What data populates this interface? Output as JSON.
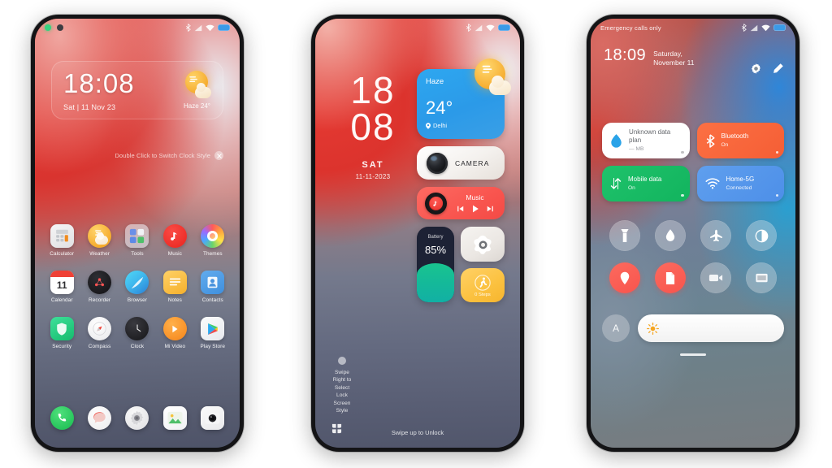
{
  "scene": {
    "background_color": "#ffffff",
    "phone_count": 3
  },
  "phone1": {
    "name": "lock-screen-home",
    "status_bar": {
      "left_text": "",
      "icons": [
        "bluetooth-icon",
        "signal-icon",
        "wifi-icon",
        "battery-icon"
      ]
    },
    "lock_card": {
      "time": "18:08",
      "date": "Sat | 11 Nov 23",
      "weather": "Haze 24°",
      "weather_icon": "haze-sun-cloud-icon"
    },
    "hint": {
      "text": "Double Click to Switch Clock Style",
      "icon": "close-icon"
    },
    "apps": [
      {
        "label": "Calculator",
        "icon": "calculator-icon",
        "color": "#e9e9ea"
      },
      {
        "label": "Weather",
        "icon": "weather-icon",
        "color": "#f6b53a"
      },
      {
        "label": "Tools",
        "icon": "tools-folder-icon",
        "color": "#f2f4f8"
      },
      {
        "label": "Music",
        "icon": "music-icon",
        "color": "#ef3b39"
      },
      {
        "label": "Themes",
        "icon": "themes-icon",
        "color": "#ffffff"
      },
      {
        "label": "Calendar",
        "icon": "calendar-icon",
        "color": "#ffffff"
      },
      {
        "label": "Recorder",
        "icon": "recorder-icon",
        "color": "#1d1d20"
      },
      {
        "label": "Browser",
        "icon": "browser-icon",
        "color": "#39b9ee"
      },
      {
        "label": "Notes",
        "icon": "notes-icon",
        "color": "#f6b93b"
      },
      {
        "label": "Contacts",
        "icon": "contacts-icon",
        "color": "#4a9fe8"
      },
      {
        "label": "Security",
        "icon": "security-icon",
        "color": "#21c46d"
      },
      {
        "label": "Compass",
        "icon": "compass-icon",
        "color": "#ffffff"
      },
      {
        "label": "Clock",
        "icon": "clock-icon",
        "color": "#222226"
      },
      {
        "label": "Mi Video",
        "icon": "mi-video-icon",
        "color": "#f7921e"
      },
      {
        "label": "Play Store",
        "icon": "play-store-icon",
        "color": "#f2f3f6"
      }
    ],
    "dock": [
      {
        "label": "Phone",
        "icon": "phone-icon",
        "color": "#2ecc5c"
      },
      {
        "label": "Messages",
        "icon": "messages-icon",
        "color": "#f2f2f3"
      },
      {
        "label": "Settings",
        "icon": "settings-gear-icon",
        "color": "#e6e6e8"
      },
      {
        "label": "Gallery",
        "icon": "gallery-icon",
        "color": "#ffffff"
      },
      {
        "label": "Camera",
        "icon": "camera-icon",
        "color": "#efeff0"
      }
    ]
  },
  "phone2": {
    "name": "lock-screen-widgets",
    "status_bar": {
      "icons": [
        "bluetooth-icon",
        "signal-icon",
        "wifi-icon",
        "battery-icon"
      ]
    },
    "clock": {
      "hours": "18",
      "minutes": "08",
      "weekday": "SAT",
      "date": "11-11-2023"
    },
    "widgets": {
      "weather": {
        "condition": "Haze",
        "temperature": "24°",
        "city": "Delhi",
        "icon": "haze-sun-cloud-icon"
      },
      "camera": {
        "label": "CAMERA",
        "icon": "camera-lens-icon"
      },
      "music": {
        "label": "Music",
        "controls": [
          "previous-icon",
          "play-icon",
          "next-icon"
        ]
      },
      "battery": {
        "label": "Battery",
        "percent": "85%",
        "fill_ratio": 0.52
      },
      "gallery": {
        "icon": "gallery-flower-icon"
      },
      "steps": {
        "label": "0 Steps",
        "icon": "running-man-icon"
      }
    },
    "swipe_right_hint": "Swipe Right to Select Lock Screen Style",
    "unlock_hint": "Swipe up to Unlock",
    "grid_button": "app-grid-icon"
  },
  "phone3": {
    "name": "control-center",
    "status_bar": {
      "left_text": "Emergency calls only",
      "icons": [
        "bluetooth-icon",
        "signal-icon",
        "wifi-icon",
        "battery-icon"
      ]
    },
    "header": {
      "time": "18:09",
      "date": "Saturday, November 11",
      "actions": [
        "settings-gear-icon",
        "edit-pencil-icon"
      ]
    },
    "tiles": [
      {
        "title": "Unknown data plan",
        "subtitle": "— MB",
        "icon": "data-usage-icon",
        "style": "tile-data"
      },
      {
        "title": "Bluetooth",
        "subtitle": "On",
        "icon": "bluetooth-icon",
        "style": "tile-bt",
        "color": "#f55e35"
      },
      {
        "title": "Mobile data",
        "subtitle": "On",
        "icon": "mobile-data-icon",
        "style": "tile-cell",
        "color": "#12b45e"
      },
      {
        "title": "Home-5G",
        "subtitle": "Connected",
        "icon": "wifi-icon",
        "style": "tile-wifi",
        "color": "#4d8fe8"
      }
    ],
    "toggles": [
      {
        "name": "flashlight-icon",
        "active": false
      },
      {
        "name": "ringtone-bell-icon",
        "active": false
      },
      {
        "name": "airplane-mode-icon",
        "active": false
      },
      {
        "name": "dark-mode-icon",
        "active": false
      },
      {
        "name": "location-icon",
        "active": true
      },
      {
        "name": "screenshot-icon",
        "active": true
      },
      {
        "name": "screen-record-icon",
        "active": false
      },
      {
        "name": "cast-screen-icon",
        "active": false
      }
    ],
    "brightness": {
      "auto_label": "A",
      "slider_icon": "sun-icon",
      "level_percent": 100
    }
  }
}
